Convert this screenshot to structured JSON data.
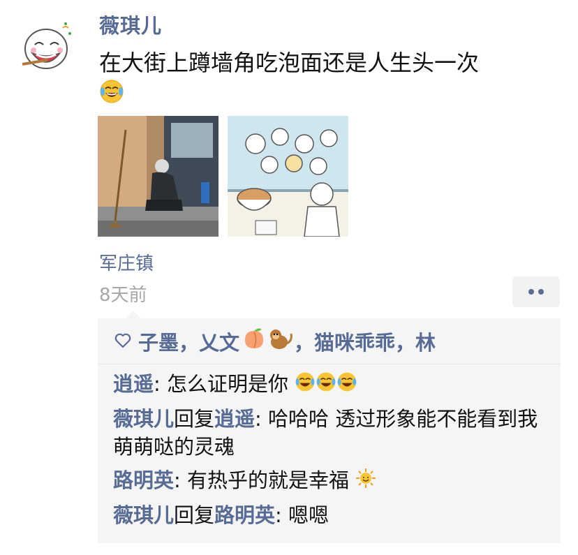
{
  "post": {
    "author": "薇琪儿",
    "text": "在大街上蹲墙角吃泡面还是人生头一次",
    "text_emoji_icon": "tears-of-joy-icon",
    "photos": [
      "street-photo-person-eating-noodles",
      "cartoon-illustration-noodles"
    ],
    "location": "军庄镇",
    "time": "8天前"
  },
  "likes": {
    "icon": "heart-outline-icon",
    "names_part1": "子墨，乂文",
    "emoji_icons": [
      "peach-icon",
      "monkey-icon"
    ],
    "names_part2": "，猫咪乖乖，林"
  },
  "comments": [
    {
      "author": "逍遥",
      "sep": ": ",
      "text": "怎么证明是你",
      "emojis": [
        "tears-of-joy-icon",
        "tears-of-joy-icon",
        "tears-of-joy-icon"
      ]
    },
    {
      "author": "薇琪儿",
      "reply_word": "回复",
      "reply_to": "逍遥",
      "sep": ": ",
      "text": "哈哈哈 透过形象能不能看到我萌萌哒的灵魂"
    },
    {
      "author": "路明英",
      "sep": ": ",
      "text": "有热乎的就是幸福",
      "emojis": [
        "sun-icon"
      ]
    },
    {
      "author": "薇琪儿",
      "reply_word": "回复",
      "reply_to": "路明英",
      "sep": ": ",
      "text": "嗯嗯"
    }
  ],
  "colors": {
    "name_blue": "#576b95",
    "time_gray": "#a8a8a8",
    "panel_bg": "#f5f5f5"
  }
}
